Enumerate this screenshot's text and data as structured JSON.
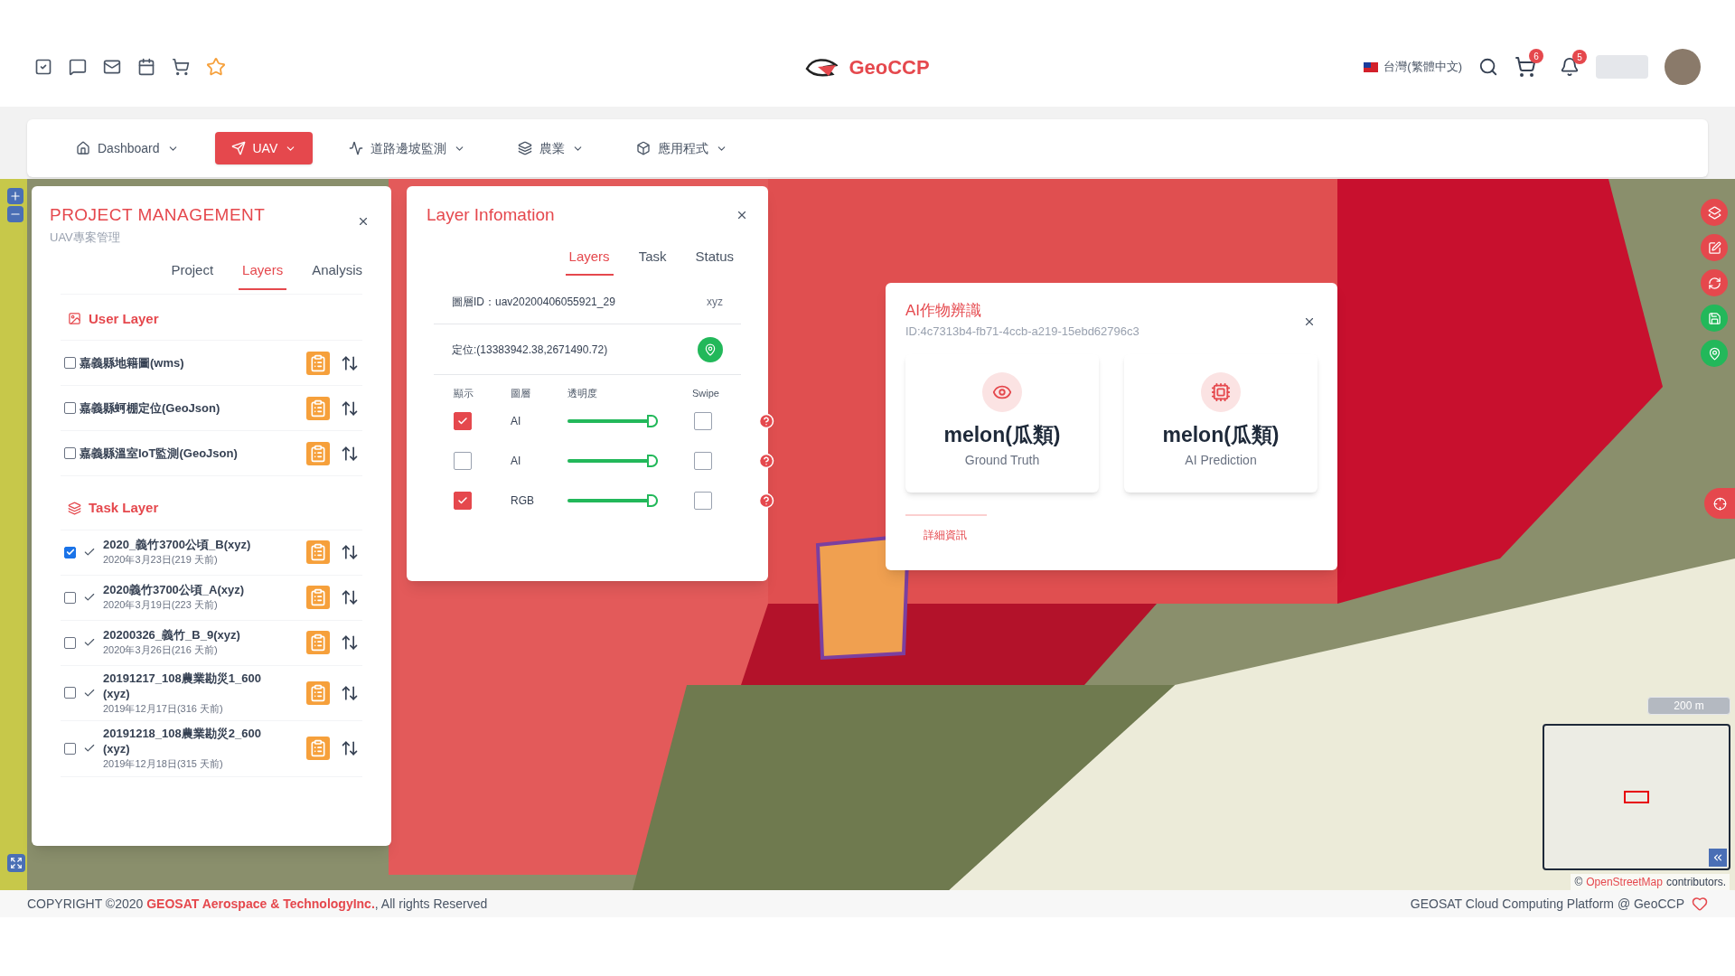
{
  "header": {
    "brand": "GeoCCP",
    "language": "台灣(繁體中文)",
    "cart_count": "6",
    "notification_count": "5"
  },
  "nav": [
    {
      "label": "Dashboard",
      "selected": false
    },
    {
      "label": "UAV",
      "selected": true
    },
    {
      "label": "道路邊坡監測",
      "selected": false
    },
    {
      "label": "農業",
      "selected": false
    },
    {
      "label": "應用程式",
      "selected": false
    }
  ],
  "project_panel": {
    "title": "PROJECT MANAGEMENT",
    "subtitle": "UAV專案管理",
    "tabs": [
      {
        "label": "Project",
        "selected": false
      },
      {
        "label": "Layers",
        "selected": true
      },
      {
        "label": "Analysis",
        "selected": false
      }
    ],
    "user_layer": {
      "title": "User Layer",
      "items": [
        {
          "label": "嘉義縣地籍圖(wms)",
          "checked": false
        },
        {
          "label": "嘉義縣蚵棚定位(GeoJson)",
          "checked": false
        },
        {
          "label": "嘉義縣溫室IoT監測(GeoJson)",
          "checked": false
        }
      ]
    },
    "task_layer": {
      "title": "Task Layer",
      "items": [
        {
          "name": "2020_義竹3700公頃_B(xyz)",
          "date": "2020年3月23日(219 天前)",
          "checked": true
        },
        {
          "name": "2020義竹3700公頃_A(xyz)",
          "date": "2020年3月19日(223 天前)",
          "checked": false
        },
        {
          "name": "20200326_義竹_B_9(xyz)",
          "date": "2020年3月26日(216 天前)",
          "checked": false
        },
        {
          "name": "20191217_108農業勘災1_600(xyz)",
          "date": "2019年12月17日(316 天前)",
          "checked": false
        },
        {
          "name": "20191218_108農業勘災2_600(xyz)",
          "date": "2019年12月18日(315 天前)",
          "checked": false
        }
      ]
    }
  },
  "layer_info": {
    "title": "Layer Infomation",
    "tabs": [
      {
        "label": "Layers",
        "selected": true
      },
      {
        "label": "Task",
        "selected": false
      },
      {
        "label": "Status",
        "selected": false
      }
    ],
    "layer_id": "圖層ID：uav20200406055921_29",
    "layer_type": "xyz",
    "location": "定位:(13383942.38,2671490.72)",
    "columns": [
      "顯示",
      "圖層",
      "透明度",
      "Swipe"
    ],
    "rows": [
      {
        "visible": true,
        "name": "AI",
        "level": 1,
        "swipe": false
      },
      {
        "visible": false,
        "name": "AI",
        "level": 1,
        "swipe": false
      },
      {
        "visible": true,
        "name": "RGB",
        "level": 1,
        "swipe": false
      }
    ]
  },
  "ai_panel": {
    "title": "AI作物辨識",
    "id": "ID:4c7313b4-fb71-4ccb-a219-15ebd62796c3",
    "cards": [
      {
        "value": "melon(瓜類)",
        "label": "Ground Truth"
      },
      {
        "value": "melon(瓜類)",
        "label": "AI Prediction"
      }
    ],
    "tab": "詳細資訊"
  },
  "map": {
    "scale": "200 m",
    "attribution_prefix": "©",
    "attribution_link": "OpenStreetMap",
    "attribution_suffix": "contributors."
  },
  "footer": {
    "copyright": "COPYRIGHT ©2020 **GEOSAT Aerospace & TechnologyInc.**, All rights Reserved",
    "platform": "GEOSAT Cloud Computing Platform @ GeoCCP"
  }
}
